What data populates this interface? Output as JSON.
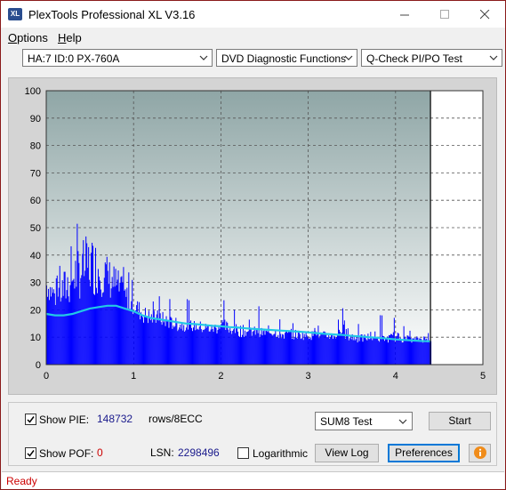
{
  "window": {
    "title": "PlexTools Professional XL V3.16",
    "icon_text": "XL",
    "controls": [
      "minimize-icon",
      "maximize-icon",
      "close-icon"
    ]
  },
  "menu": {
    "items": [
      {
        "label": "Options",
        "accel": "O",
        "rest": "ptions"
      },
      {
        "label": "Help",
        "accel": "H",
        "rest": "elp"
      }
    ]
  },
  "toolbar": {
    "drive": "HA:7 ID:0  PX-760A",
    "function": "DVD Diagnostic Functions",
    "test": "Q-Check PI/PO Test"
  },
  "chart_data": {
    "type": "bar",
    "title": "",
    "xlabel": "",
    "ylabel": "",
    "xlim": [
      0,
      5
    ],
    "ylim": [
      0,
      100
    ],
    "x_ticks": [
      0,
      1,
      2,
      3,
      4,
      5
    ],
    "y_ticks": [
      0,
      10,
      20,
      30,
      40,
      50,
      60,
      70,
      80,
      90,
      100
    ],
    "grid": true,
    "data_end_x": 4.4,
    "series": [
      {
        "kind": "bar",
        "color": "#0000ff",
        "x": [
          0.0,
          0.1,
          0.2,
          0.3,
          0.4,
          0.5,
          0.6,
          0.7,
          0.8,
          0.9,
          1.0,
          1.1,
          1.2,
          1.3,
          1.4,
          1.5,
          1.6,
          1.7,
          1.8,
          1.9,
          2.0,
          2.1,
          2.2,
          2.3,
          2.4,
          2.5,
          2.6,
          2.7,
          2.8,
          2.9,
          3.0,
          3.1,
          3.2,
          3.3,
          3.4,
          3.5,
          3.6,
          3.7,
          3.8,
          3.9,
          4.0,
          4.1,
          4.2,
          4.3,
          4.4
        ],
        "values": [
          34,
          30,
          35,
          42,
          46,
          48,
          45,
          40,
          36,
          30,
          26,
          22,
          20,
          20,
          18,
          17,
          17,
          16,
          16,
          15,
          18,
          15,
          15,
          14,
          14,
          13,
          14,
          13,
          13,
          13,
          12,
          13,
          12,
          12,
          15,
          12,
          11,
          12,
          11,
          11,
          12,
          11,
          10,
          11,
          10
        ],
        "baseline": [
          24,
          20,
          20,
          22,
          24,
          25,
          25,
          24,
          22,
          20,
          18,
          15,
          14,
          14,
          13,
          12,
          12,
          12,
          11,
          11,
          11,
          11,
          10,
          10,
          10,
          10,
          10,
          9,
          9,
          9,
          9,
          9,
          9,
          9,
          9,
          8,
          8,
          8,
          8,
          8,
          8,
          8,
          8,
          8,
          8
        ]
      },
      {
        "kind": "line",
        "color": "#22c8e6",
        "x": [
          0.0,
          0.1,
          0.2,
          0.3,
          0.4,
          0.5,
          0.6,
          0.7,
          0.8,
          0.9,
          1.0,
          1.1,
          1.2,
          1.3,
          1.4,
          1.5,
          1.6,
          1.7,
          1.8,
          1.9,
          2.0,
          2.1,
          2.2,
          2.3,
          2.4,
          2.5,
          2.6,
          2.7,
          2.8,
          2.9,
          3.0,
          3.1,
          3.2,
          3.3,
          3.4,
          3.5,
          3.6,
          3.7,
          3.8,
          3.9,
          4.0,
          4.1,
          4.2,
          4.3,
          4.4
        ],
        "values": [
          18.5,
          18,
          18,
          18.5,
          19.5,
          20.5,
          21,
          21.5,
          21.5,
          20.5,
          19.5,
          18,
          17,
          16.5,
          16,
          15.5,
          15,
          14.8,
          14.5,
          14.2,
          14,
          13.7,
          13.5,
          13.2,
          13,
          12.8,
          12.6,
          12.4,
          12.2,
          12,
          11.8,
          11.5,
          11.2,
          11,
          10.8,
          10.5,
          10.3,
          10,
          9.8,
          9.5,
          9.2,
          9,
          8.8,
          8.6,
          8.5
        ]
      }
    ]
  },
  "bottom": {
    "show_pie_label": "Show PIE:",
    "show_pie_checked": true,
    "pie_value": "148732",
    "pie_unit": "rows/8ECC",
    "show_pof_label": "Show POF:",
    "show_pof_checked": true,
    "pof_value": "0",
    "lsn_label": "LSN:",
    "lsn_value": "2298496",
    "log_label": "Logarithmic",
    "log_checked": false,
    "test_select": "SUM8 Test",
    "start_button": "Start",
    "viewlog_button": "View Log",
    "prefs_button": "Preferences",
    "info_icon": "info-icon"
  },
  "status": {
    "text": "Ready"
  }
}
